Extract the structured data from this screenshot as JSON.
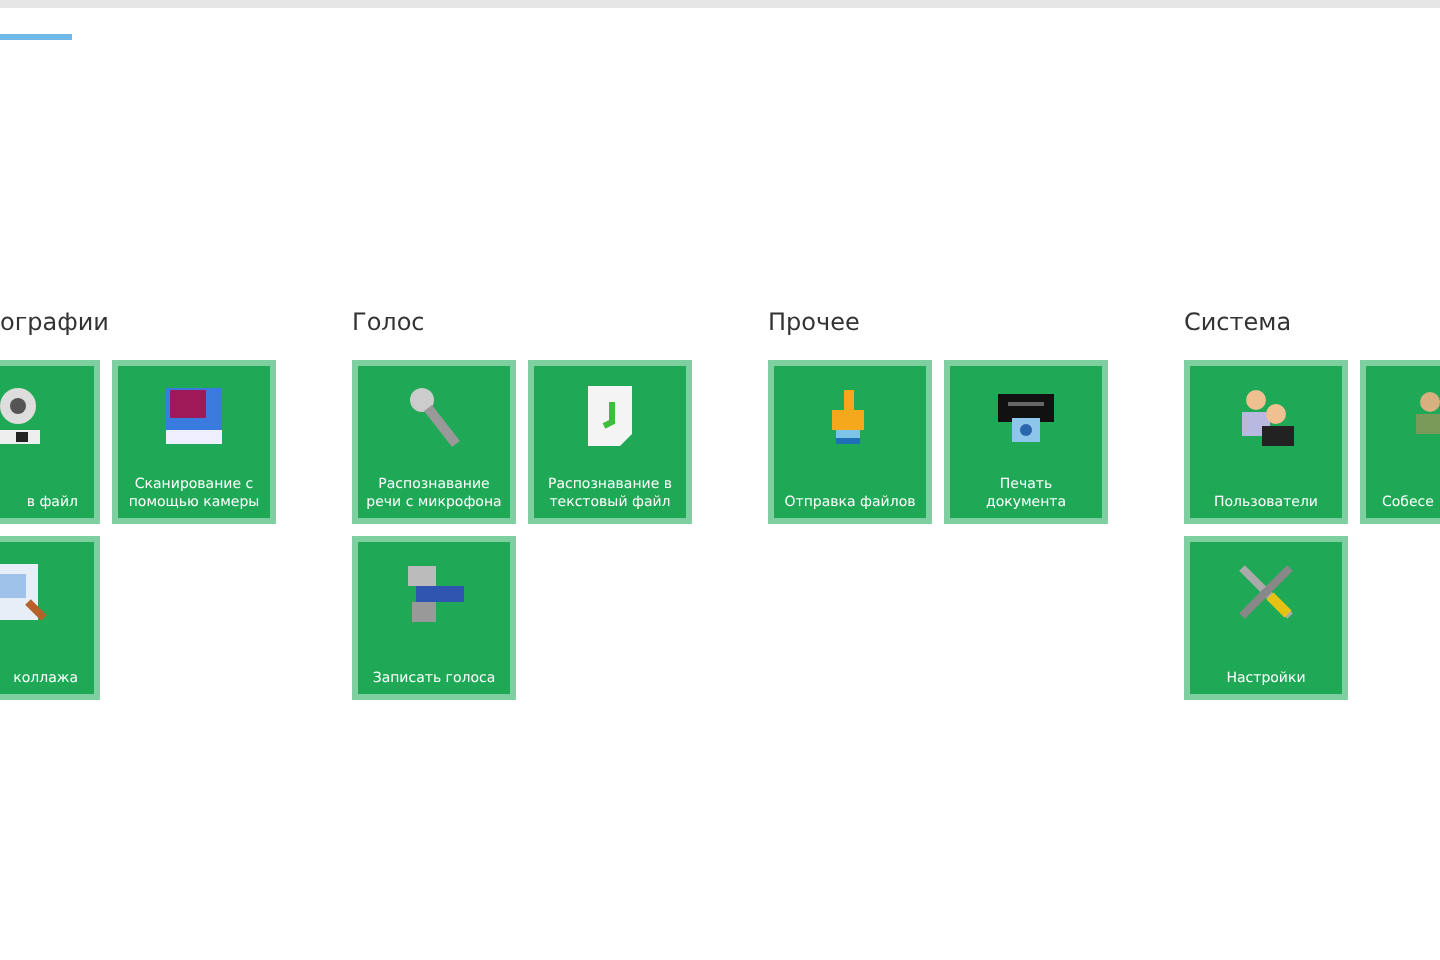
{
  "groups": [
    {
      "title": "ографии",
      "tiles": [
        {
          "label": "в файл"
        },
        {
          "label": "Сканирование с помощью камеры"
        },
        {
          "label": "коллажа"
        }
      ]
    },
    {
      "title": "Голос",
      "tiles": [
        {
          "label": "Распознавание речи с микрофона"
        },
        {
          "label": "Распознавание в текстовый файл"
        },
        {
          "label": "Записать голоса"
        }
      ]
    },
    {
      "title": "Прочее",
      "tiles": [
        {
          "label": "Отправка файлов"
        },
        {
          "label": "Печать документа"
        }
      ]
    },
    {
      "title": "Система",
      "tiles": [
        {
          "label": "Пользователи"
        },
        {
          "label": "Собесе"
        },
        {
          "label": "Настройки"
        }
      ]
    }
  ]
}
